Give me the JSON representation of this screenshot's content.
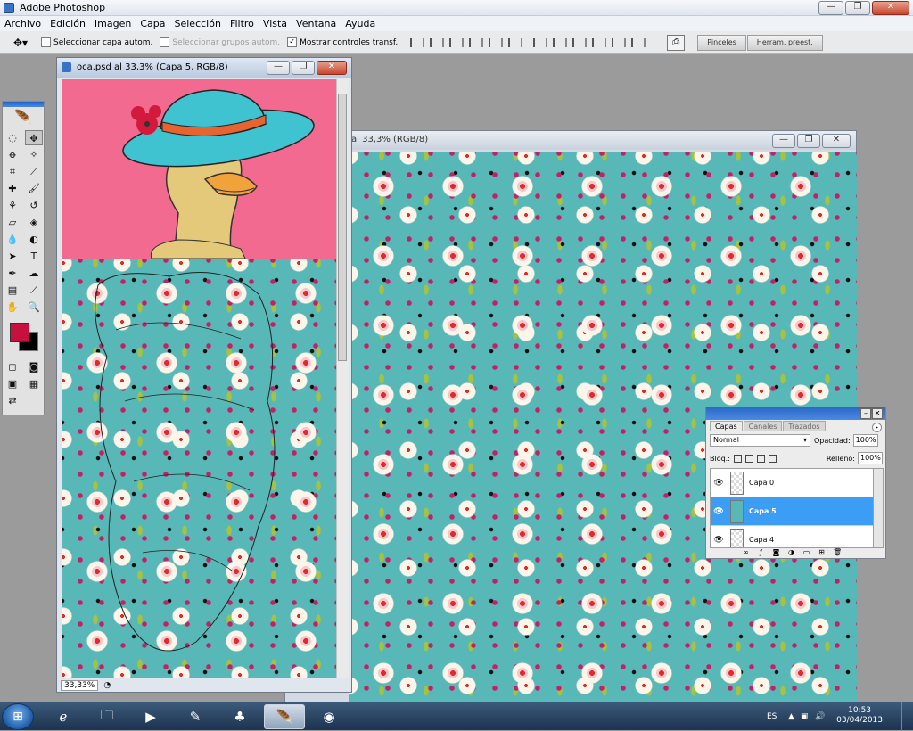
{
  "app": {
    "title": "Adobe Photoshop"
  },
  "menu": [
    "Archivo",
    "Edición",
    "Imagen",
    "Capa",
    "Selección",
    "Filtro",
    "Vista",
    "Ventana",
    "Ayuda"
  ],
  "options": {
    "auto_select_layer": "Seleccionar capa autom.",
    "auto_select_groups": "Seleccionar grupos autom.",
    "show_transform": "Mostrar controles transf."
  },
  "well_tabs": [
    "Pinceles",
    "Herram. preest."
  ],
  "doc_front": {
    "title": "oca.psd al 33,3% (Capa 5, RGB/8)",
    "zoom": "33,33%"
  },
  "doc_back": {
    "title": "al 33,3% (RGB/8)"
  },
  "layers_panel": {
    "tabs": [
      "Capas",
      "Canales",
      "Trazados"
    ],
    "blend_mode": "Normal",
    "opacity_label": "Opacidad:",
    "opacity_value": "100%",
    "lock_label": "Bloq.:",
    "fill_label": "Relleno:",
    "fill_value": "100%",
    "layers": [
      {
        "name": "Capa 0",
        "active": false
      },
      {
        "name": "Capa 5",
        "active": true
      },
      {
        "name": "Capa 4",
        "active": false
      }
    ]
  },
  "taskbar": {
    "language": "ES",
    "time": "10:53",
    "date": "03/04/2013"
  },
  "colors": {
    "foreground": "#c8103f",
    "background": "#000000",
    "canvas_pink": "#f26a8f",
    "fabric": "#58b7b7",
    "selected_layer": "#3b9df3"
  }
}
